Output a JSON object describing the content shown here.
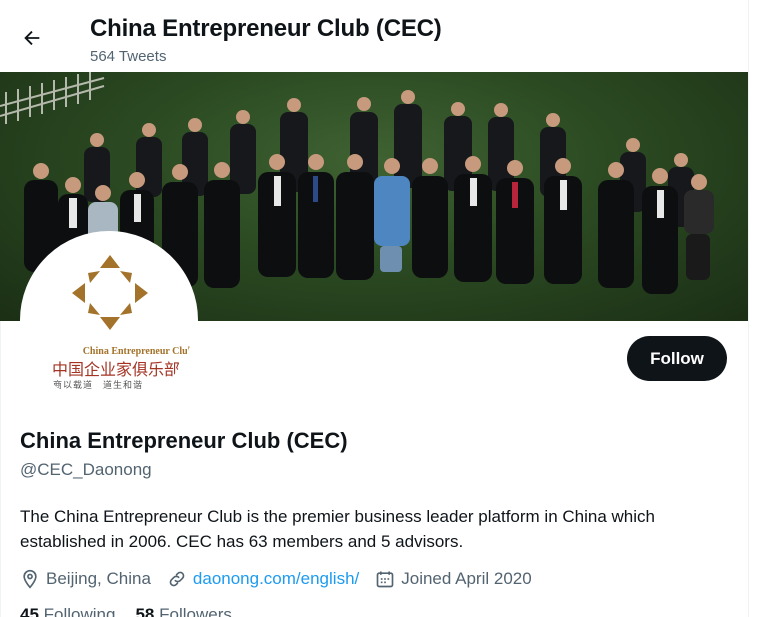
{
  "header": {
    "title": "China Entrepreneur Club (CEC)",
    "tweet_count": "564 Tweets",
    "back_icon": "arrow-left-icon"
  },
  "banner": {
    "description_icon": "group-photo"
  },
  "avatar": {
    "logo_en": "China Entrepreneur Club",
    "logo_cn": "中国企业家俱乐部",
    "logo_motto": "商以载道　道生和谐"
  },
  "actions": {
    "follow_label": "Follow"
  },
  "profile": {
    "name": "China Entrepreneur Club (CEC)",
    "handle": "@CEC_Daonong",
    "bio": "The China Entrepreneur Club is the premier business leader platform in China which established in 2006. CEC has 63 members and 5 advisors.",
    "location": "Beijing, China",
    "website": "daonong.com/english/",
    "joined": "Joined April 2020",
    "following_count": "45",
    "following_label": "Following",
    "followers_count": "58",
    "followers_label": "Followers"
  },
  "colors": {
    "link": "#1d9bf0",
    "secondary_text": "#536471",
    "primary_text": "#0f1419",
    "logo_gold": "#a3732b",
    "logo_red": "#a33424"
  }
}
